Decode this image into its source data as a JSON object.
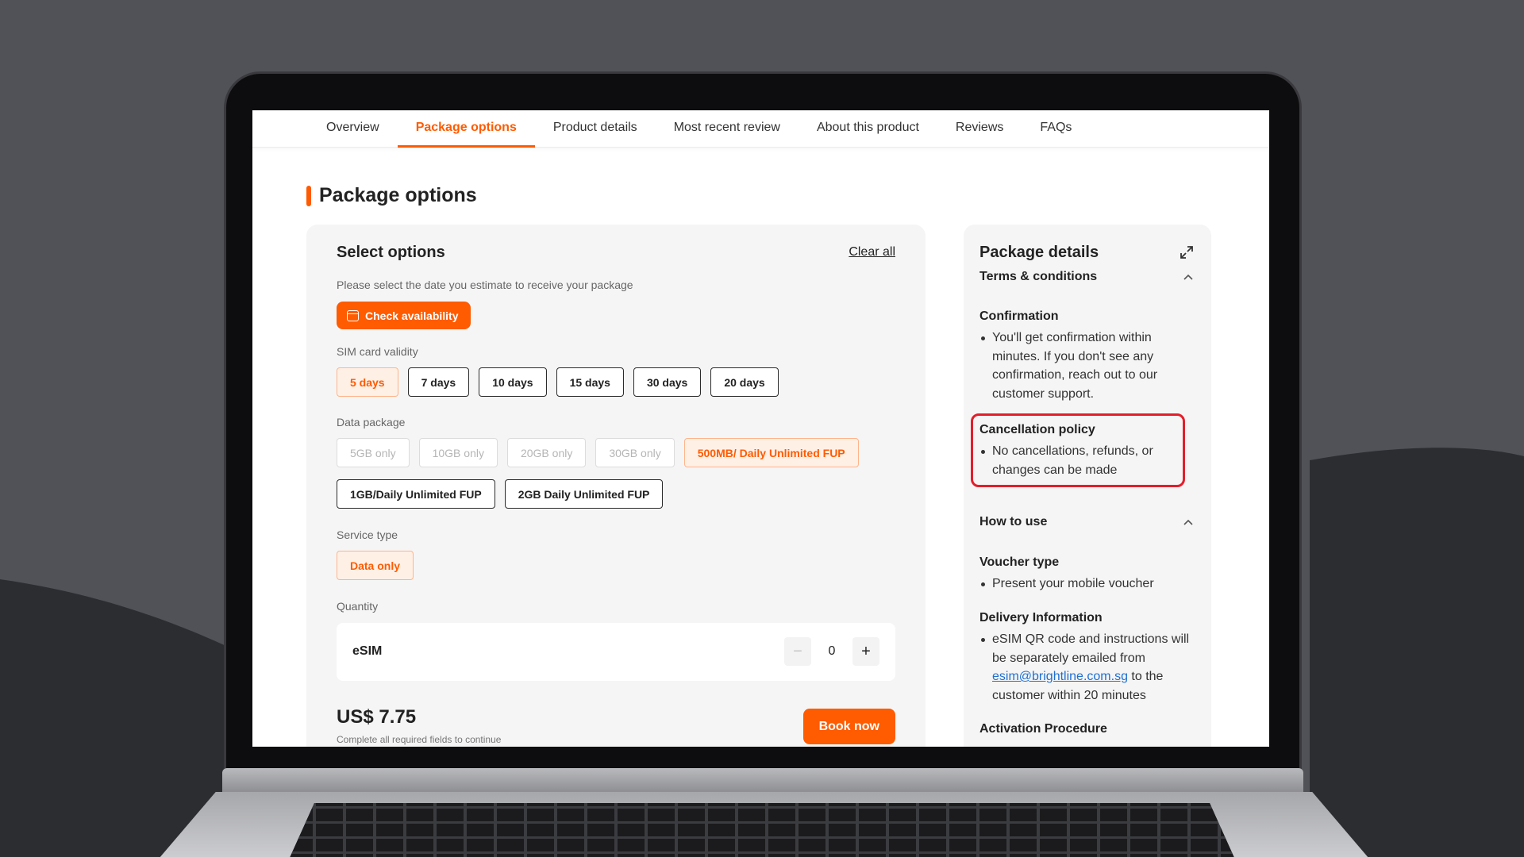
{
  "colors": {
    "accent": "#ff5b00",
    "highlight": "#e31e2a",
    "link": "#1f6fd1"
  },
  "tabs": [
    {
      "label": "Overview"
    },
    {
      "label": "Package options"
    },
    {
      "label": "Product details"
    },
    {
      "label": "Most recent review"
    },
    {
      "label": "About this product"
    },
    {
      "label": "Reviews"
    },
    {
      "label": "FAQs"
    }
  ],
  "active_tab": "Package options",
  "section_title": "Package options",
  "options": {
    "title": "Select options",
    "clear_all": "Clear all",
    "date_hint": "Please select the date you estimate to receive your package",
    "check_availability": "Check availability",
    "validity_label": "SIM card validity",
    "validity": [
      "5 days",
      "7 days",
      "10 days",
      "15 days",
      "30 days",
      "20 days"
    ],
    "validity_selected": "5 days",
    "data_label": "Data package",
    "data_row1": [
      "5GB only",
      "10GB only",
      "20GB only",
      "30GB only",
      "500MB/ Daily Unlimited FUP"
    ],
    "data_row2": [
      "1GB/Daily Unlimited FUP",
      "2GB Daily Unlimited FUP"
    ],
    "data_selected": "500MB/ Daily Unlimited FUP",
    "service_label": "Service type",
    "service_option": "Data only",
    "quantity_label": "Quantity",
    "quantity_item": "eSIM",
    "quantity_value": "0",
    "minus": "−",
    "plus": "+",
    "price": "US$ 7.75",
    "price_note": "Complete all required fields to continue",
    "book_now": "Book now"
  },
  "details": {
    "title": "Package details",
    "terms_title": "Terms & conditions",
    "confirmation_title": "Confirmation",
    "confirmation_text": "You'll get confirmation within minutes. If you don't see any confirmation, reach out to our customer support.",
    "cancellation_title": "Cancellation policy",
    "cancellation_text": "No cancellations, refunds, or changes can be made",
    "how_to_use_title": "How to use",
    "voucher_title": "Voucher type",
    "voucher_text": "Present your mobile voucher",
    "delivery_title": "Delivery Information",
    "delivery_text_a": "eSIM QR code and instructions will be separately emailed from",
    "delivery_email": "esim@brightline.com.sg",
    "delivery_text_b": "to the customer within 20 minutes",
    "activation_title": "Activation Procedure"
  },
  "icons": {
    "calendar": "calendar-icon",
    "expand": "expand-icon",
    "chevron": "chevron-up-icon"
  }
}
